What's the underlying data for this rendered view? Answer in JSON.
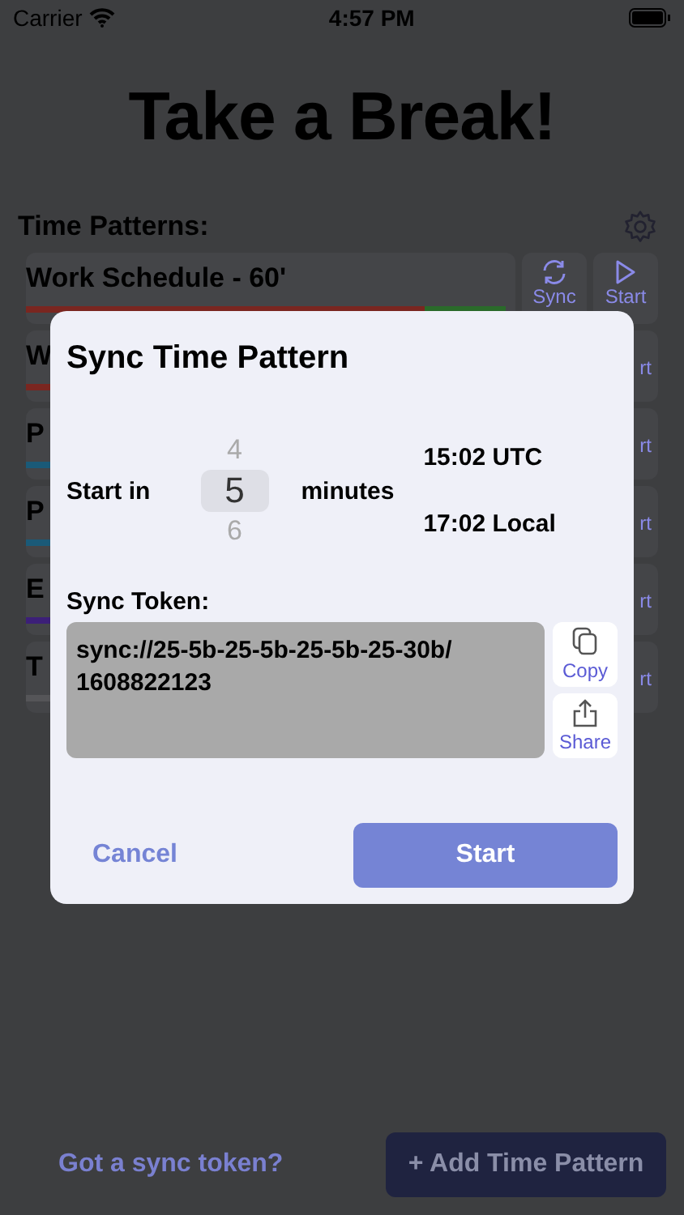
{
  "status_bar": {
    "carrier": "Carrier",
    "time": "4:57 PM"
  },
  "title": "Take a Break!",
  "patterns_header": "Time Patterns:",
  "patterns": [
    {
      "name": "Work Schedule - 60'",
      "segments": [
        {
          "color": "#7a2620",
          "level": 0.83
        },
        {
          "color": "#2a6a2a",
          "level": 0.17
        }
      ],
      "sync_label": "Sync",
      "start_label": "Start"
    },
    {
      "name": "W",
      "segments": [
        {
          "color": "#7a2620",
          "level": 1
        }
      ],
      "start_label": "rt"
    },
    {
      "name": "P",
      "segments": [
        {
          "color": "#1a5a78",
          "level": 1
        }
      ],
      "start_label": "rt"
    },
    {
      "name": "P",
      "segments": [
        {
          "color": "#1a5a78",
          "level": 1
        }
      ],
      "start_label": "rt"
    },
    {
      "name": "E",
      "segments": [
        {
          "color": "#3c1f78",
          "level": 1
        }
      ],
      "start_label": "rt"
    },
    {
      "name": "T",
      "segments": [
        {
          "color": "#555558",
          "level": 1
        }
      ],
      "start_label": "rt"
    }
  ],
  "footer": {
    "link": "Got a sync token?",
    "add_button": "+ Add Time Pattern"
  },
  "dialog": {
    "title": "Sync Time Pattern",
    "start_label": "Start in",
    "picker": [
      {
        "value": "4",
        "selected": false
      },
      {
        "value": "5",
        "selected": true
      },
      {
        "value": "6",
        "selected": false
      }
    ],
    "unit": "minutes",
    "utc_time": "15:02 UTC",
    "local_time": "17:02 Local",
    "token_label": "Sync Token:",
    "token": "sync://25-5b-25-5b-25-5b-25-30b/ 1608822123",
    "copy_label": "Copy",
    "share_label": "Share",
    "cancel": "Cancel",
    "start": "Start"
  }
}
